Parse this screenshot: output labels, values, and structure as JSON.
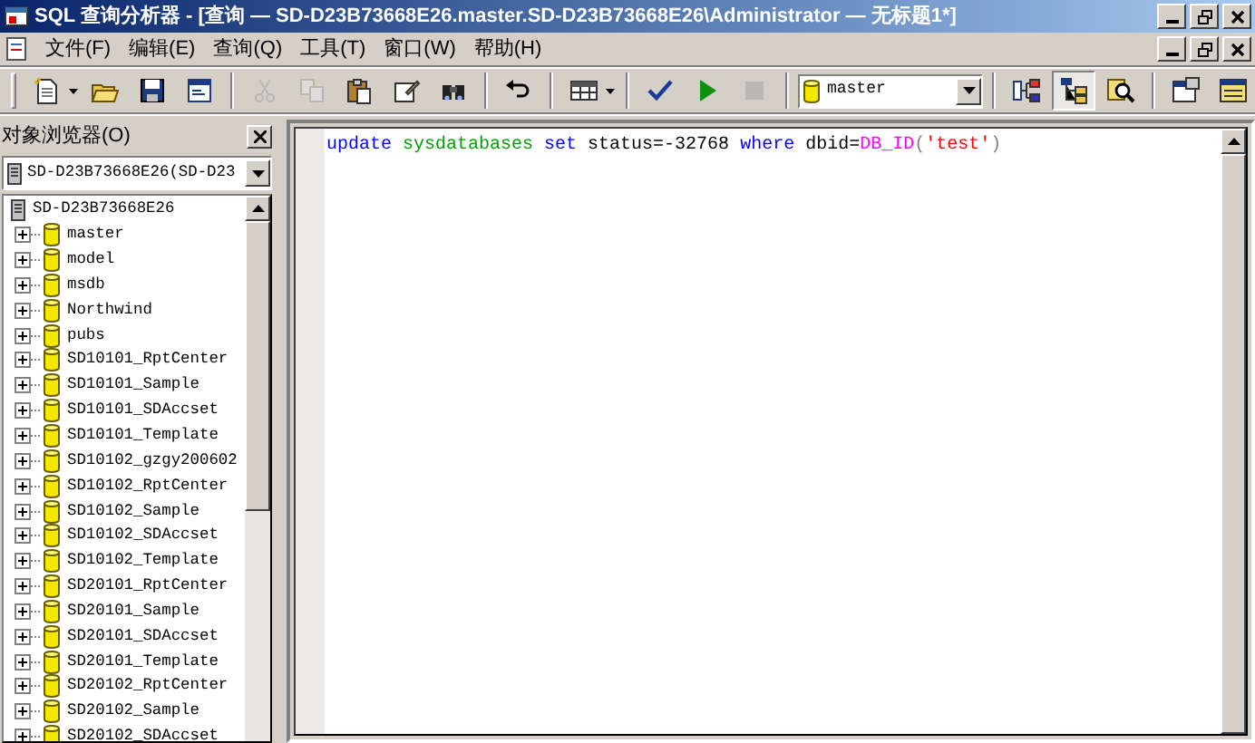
{
  "window": {
    "title": "SQL 查询分析器 - [查询 — SD-D23B73668E26.master.SD-D23B73668E26\\Administrator — 无标题1*]"
  },
  "menu": [
    "文件(F)",
    "编辑(E)",
    "查询(Q)",
    "工具(T)",
    "窗口(W)",
    "帮助(H)"
  ],
  "toolbar": [
    [
      {
        "kind": "new",
        "disabled": false
      },
      {
        "kind": "caret",
        "disabled": false
      },
      {
        "kind": "open",
        "disabled": false
      },
      {
        "kind": "save",
        "disabled": false
      },
      {
        "kind": "script",
        "disabled": false
      }
    ],
    [
      {
        "kind": "cut",
        "disabled": true
      },
      {
        "kind": "copy",
        "disabled": true
      },
      {
        "kind": "paste",
        "disabled": false
      },
      {
        "kind": "edit",
        "disabled": false
      },
      {
        "kind": "find",
        "disabled": false
      }
    ],
    [
      {
        "kind": "undo",
        "disabled": false
      }
    ],
    [
      {
        "kind": "grid",
        "disabled": false
      },
      {
        "kind": "caret",
        "disabled": false
      }
    ],
    [
      {
        "kind": "parse",
        "disabled": false
      },
      {
        "kind": "run",
        "disabled": false
      },
      {
        "kind": "stop",
        "disabled": true
      }
    ],
    [
      {
        "kind": "database",
        "value": "master"
      }
    ],
    [
      {
        "kind": "plan",
        "disabled": false,
        "selected": false
      },
      {
        "kind": "browser",
        "disabled": false,
        "selected": true
      },
      {
        "kind": "search",
        "disabled": false,
        "selected": false
      }
    ],
    [
      {
        "kind": "options",
        "disabled": false
      },
      {
        "kind": "results",
        "disabled": false
      }
    ]
  ],
  "object_browser": {
    "title": "对象浏览器(O)",
    "server_combo": "SD-D23B73668E26(SD-D23",
    "tree": {
      "label": "SD-D23B73668E26",
      "expanded": true,
      "children": [
        {
          "label": "master",
          "expanded": false
        },
        {
          "label": "model",
          "expanded": false
        },
        {
          "label": "msdb",
          "expanded": false
        },
        {
          "label": "Northwind",
          "expanded": false
        },
        {
          "label": "pubs",
          "expanded": false
        },
        {
          "label": "SD10101_RptCenter",
          "expanded": false
        },
        {
          "label": "SD10101_Sample",
          "expanded": false
        },
        {
          "label": "SD10101_SDAccset",
          "expanded": false
        },
        {
          "label": "SD10101_Template",
          "expanded": false
        },
        {
          "label": "SD10102_gzgy200602",
          "expanded": false
        },
        {
          "label": "SD10102_RptCenter",
          "expanded": false
        },
        {
          "label": "SD10102_Sample",
          "expanded": false
        },
        {
          "label": "SD10102_SDAccset",
          "expanded": false
        },
        {
          "label": "SD10102_Template",
          "expanded": false
        },
        {
          "label": "SD20101_RptCenter",
          "expanded": false
        },
        {
          "label": "SD20101_Sample",
          "expanded": false
        },
        {
          "label": "SD20101_SDAccset",
          "expanded": false
        },
        {
          "label": "SD20101_Template",
          "expanded": false
        },
        {
          "label": "SD20102_RptCenter",
          "expanded": false
        },
        {
          "label": "SD20102_Sample",
          "expanded": false
        },
        {
          "label": "SD20102_SDAccset",
          "expanded": false
        }
      ]
    }
  },
  "editor": {
    "lines": [
      [
        {
          "text": "update ",
          "kind": "keyword"
        },
        {
          "text": "sysdatabases ",
          "kind": "table"
        },
        {
          "text": "set",
          "kind": "keyword"
        },
        {
          "text": " status=-32768 ",
          "kind": "plain"
        },
        {
          "text": "where",
          "kind": "keyword"
        },
        {
          "text": " dbid=",
          "kind": "plain"
        },
        {
          "text": "DB_ID",
          "kind": "function"
        },
        {
          "text": "(",
          "kind": "operator"
        },
        {
          "text": "'test'",
          "kind": "string"
        },
        {
          "text": ")",
          "kind": "operator"
        }
      ]
    ]
  }
}
